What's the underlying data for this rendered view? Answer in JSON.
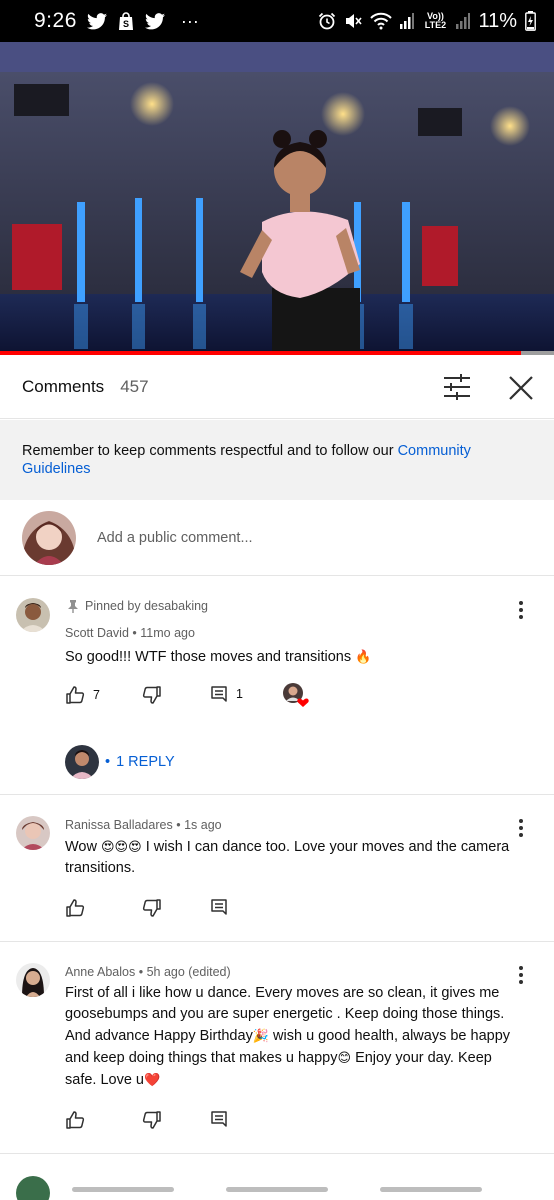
{
  "status_bar": {
    "time": "9:26",
    "icons": [
      "twitter-icon",
      "shopping-bag-icon",
      "twitter-icon",
      "more-dots-icon",
      "alarm-icon",
      "mute-icon",
      "wifi-icon",
      "signal-icon",
      "volte-lte2-icon",
      "signal-icon",
      "battery-icon"
    ],
    "more": "···",
    "volte": "Vo)) LTE2",
    "battery": "11%"
  },
  "player": {
    "progress_fraction": 0.94,
    "accent": "#ff0000"
  },
  "comments_panel": {
    "title": "Comments",
    "count": "457",
    "filter_icon": "sliders-icon",
    "close_icon": "close-icon"
  },
  "notice": {
    "text": "Remember to keep comments respectful and to follow our ",
    "link": "Community Guidelines",
    "link_color": "#065fd4"
  },
  "add_comment": {
    "placeholder": "Add a public comment..."
  },
  "comments": [
    {
      "pinned": "Pinned by desabaking",
      "author": "Scott David",
      "time": "11mo ago",
      "text": "So good!!! WTF those moves and transitions ",
      "emoji": "🔥",
      "likes": "7",
      "replies_count": "1",
      "hearted": true,
      "reply_link": "1 REPLY"
    },
    {
      "author": "Ranissa Balladares",
      "time": "1s ago",
      "text_parts": [
        "Wow ",
        "😍😍😍",
        " I wish I can dance too. Love your moves and the camera transitions."
      ]
    },
    {
      "author": "Anne Abalos",
      "time": "5h ago (edited)",
      "text_parts": [
        "First of all i like how u dance. Every moves are so clean, it gives me goosebumps and you are super energetic . Keep doing those things. And advance Happy Birthday",
        "🎉",
        " wish u good health, always be happy and keep doing things that makes u happy",
        "😊",
        " Enjoy your day. Keep safe. Love u",
        "❤️"
      ]
    }
  ],
  "meta_separator": "•"
}
